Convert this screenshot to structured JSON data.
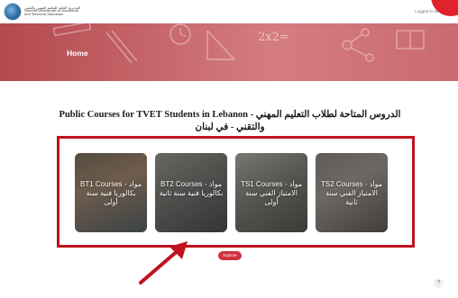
{
  "header": {
    "logo_line_ar": "المديرية العامة للتعليم المهني والتقني",
    "logo_line_1": "General Directorate of Vocational",
    "logo_line_2": "and Technical Education",
    "logged_in_text": "Logged in as"
  },
  "banner": {
    "page_title": "Home",
    "formula_text": "2x2="
  },
  "section": {
    "title_ar": "الدروس المتاحة لطلاب التعليم المهني والتقني - في لبنان",
    "title_en": "Public Courses for TVET Students in Lebanon"
  },
  "courses": [
    {
      "label": "BT1 Courses - مواد بكالوريا فنية سنة أولى"
    },
    {
      "label": "BT2 Courses - مواد بكالوريا فنية سنة ثانية"
    },
    {
      "label": "TS1 Courses - مواد الامتياز الفني سنة أولى"
    },
    {
      "label": "TS2 Courses - مواد الامتياز الفني سنة ثانية"
    }
  ],
  "explore_button": "Explore",
  "help_icon_glyph": "?",
  "colors": {
    "accent_red": "#c1121c",
    "banner_red": "#c7676b"
  }
}
